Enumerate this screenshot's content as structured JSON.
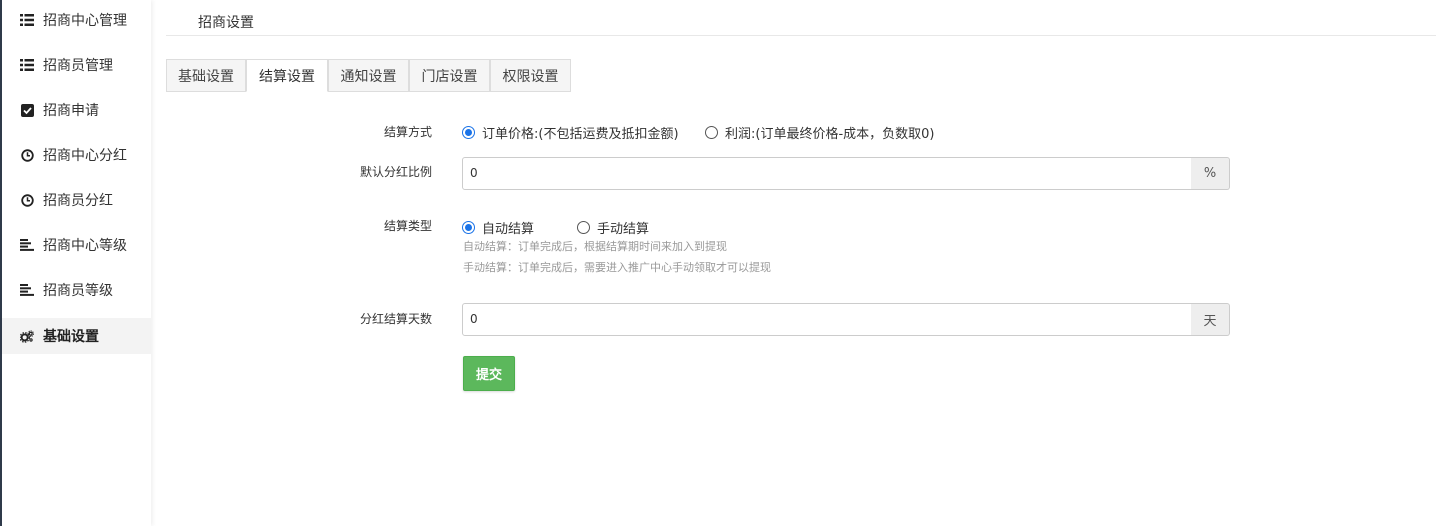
{
  "sidebar": {
    "items": [
      {
        "label": "招商中心管理",
        "icon": "list-icon"
      },
      {
        "label": "招商员管理",
        "icon": "list-icon"
      },
      {
        "label": "招商申请",
        "icon": "checkbox-icon"
      },
      {
        "label": "招商中心分红",
        "icon": "clock-icon"
      },
      {
        "label": "招商员分红",
        "icon": "clock-icon"
      },
      {
        "label": "招商中心等级",
        "icon": "align-left-icon"
      },
      {
        "label": "招商员等级",
        "icon": "align-left-icon"
      },
      {
        "label": "基础设置",
        "icon": "cogs-icon",
        "active": true
      }
    ]
  },
  "header": {
    "title": "招商设置"
  },
  "tabs": [
    {
      "label": "基础设置"
    },
    {
      "label": "结算设置",
      "active": true
    },
    {
      "label": "通知设置"
    },
    {
      "label": "门店设置"
    },
    {
      "label": "权限设置"
    }
  ],
  "form": {
    "settle_method": {
      "label": "结算方式",
      "options": [
        "订单价格:(不包括运费及抵扣金额)",
        "利润:(订单最终价格-成本，负数取0)"
      ],
      "selected": 0
    },
    "default_ratio": {
      "label": "默认分红比例",
      "value": "0",
      "unit": "%"
    },
    "settle_type": {
      "label": "结算类型",
      "options": [
        "自动结算",
        "手动结算"
      ],
      "selected": 0,
      "help": [
        "自动结算：订单完成后，根据结算期时间来加入到提现",
        "手动结算：订单完成后，需要进入推广中心手动领取才可以提现"
      ]
    },
    "settle_days": {
      "label": "分红结算天数",
      "value": "0",
      "unit": "天"
    },
    "submit_label": "提交"
  },
  "colors": {
    "accent": "#1a73e8",
    "submit": "#5cb85c",
    "sidebar_border": "#2f3a4a"
  }
}
